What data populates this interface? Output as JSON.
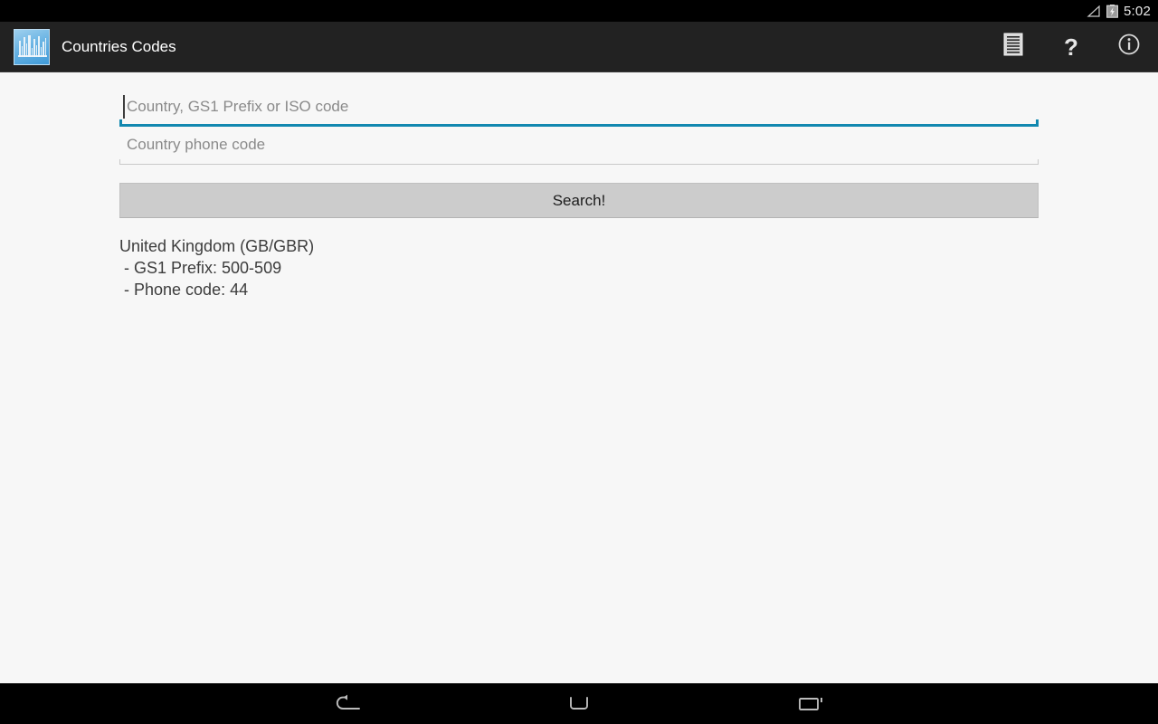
{
  "status_bar": {
    "clock": "5:02",
    "signal_icon": "signal-triangle-icon",
    "battery_icon": "battery-charging-icon"
  },
  "action_bar": {
    "app_icon": "app-logo-icon",
    "title": "Countries Codes",
    "actions": [
      {
        "name": "list-icon",
        "label": ""
      },
      {
        "name": "help-question-icon",
        "label": "?"
      },
      {
        "name": "info-circle-icon",
        "label": ""
      }
    ]
  },
  "form": {
    "country_field": {
      "placeholder": "Country, GS1 Prefix or ISO code",
      "value": "",
      "focused": true
    },
    "phone_field": {
      "placeholder": "Country phone code",
      "value": "",
      "focused": false
    },
    "search_button_label": "Search!"
  },
  "results": {
    "lines": [
      "United Kingdom (GB/GBR)",
      "- GS1 Prefix: 500-509",
      "- Phone code: 44"
    ],
    "country": "United Kingdom",
    "iso_alpha2": "GB",
    "iso_alpha3": "GBR",
    "gs1_prefix": "500-509",
    "phone_code": "44"
  },
  "navigation_bar": {
    "back_label": "back-icon",
    "home_label": "home-icon",
    "recents_label": "recents-icon"
  },
  "colors": {
    "action_bar_bg": "#222222",
    "page_bg": "#f7f7f7",
    "focus_accent": "#1288b0",
    "button_bg": "#cccccc",
    "placeholder": "#8a8a8a",
    "text": "#3c3c3c"
  }
}
